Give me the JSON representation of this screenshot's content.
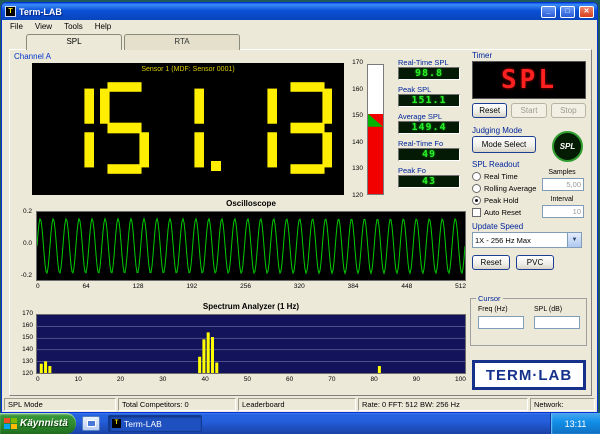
{
  "window": {
    "title": "Term-LAB",
    "menu": [
      "File",
      "View",
      "Tools",
      "Help"
    ],
    "tabs": [
      "SPL",
      "RTA"
    ]
  },
  "channel": {
    "label": "Channel A"
  },
  "main_display": {
    "sensor_label": "Sensor 1 (MDF: Sensor 0001)",
    "value": "151.13",
    "digit_color": "#ffee00",
    "bg_color": "#000000"
  },
  "meter": {
    "min": 120,
    "max": 170,
    "ticks": [
      170,
      160,
      150,
      140,
      130,
      120
    ],
    "fill_to": 151.1,
    "green_band": [
      149.4,
      151.1
    ],
    "fill_color": "#f20000",
    "band_color": "#00b400"
  },
  "readouts": [
    {
      "label": "Real-Time SPL",
      "value": "98.8"
    },
    {
      "label": "Peak SPL",
      "value": "151.1"
    },
    {
      "label": "Average SPL",
      "value": "149.4"
    },
    {
      "label": "Real-Time Fo",
      "value": "49"
    },
    {
      "label": "Peak Fo",
      "value": "43"
    }
  ],
  "timer": {
    "label": "Timer",
    "display": "SPL",
    "buttons": [
      {
        "label": "Reset",
        "enabled": true
      },
      {
        "label": "Start",
        "enabled": false
      },
      {
        "label": "Stop",
        "enabled": false
      }
    ]
  },
  "judging_mode": {
    "label": "Judging Mode",
    "button": "Mode Select",
    "logo": "SPL"
  },
  "spl_readout": {
    "label": "SPL Readout",
    "options": [
      {
        "label": "Real Time",
        "selected": false
      },
      {
        "label": "Rolling Average",
        "selected": false
      },
      {
        "label": "Peak Hold",
        "selected": true
      }
    ],
    "auto_reset": {
      "label": "Auto Reset",
      "checked": false
    },
    "samples": {
      "label": "Samples",
      "value": "5,00"
    },
    "interval": {
      "label": "Interval",
      "value": "10"
    }
  },
  "update_speed": {
    "label": "Update Speed",
    "value": "1X - 256 Hz Max"
  },
  "buttons": {
    "reset": "Reset",
    "pvc": "PVC"
  },
  "cursor": {
    "label": "Cursor",
    "freq_label": "Freq (Hz)",
    "spl_label": "SPL (dB)",
    "freq_value": "",
    "spl_value": ""
  },
  "logo": {
    "text": "TERM·LAB"
  },
  "status_bar": [
    "SPL Mode",
    "Total Competitors: 0",
    "Leaderboard",
    "Rate: 0 FFT: 512 BW: 256 Hz",
    "Network:"
  ],
  "taskbar": {
    "start_label": "Käynnistä",
    "task_label": "Term-LAB",
    "clock": "13:11"
  },
  "colors": {
    "led": "#2bee2b",
    "timer_display": "#ff2020",
    "label_blue": "#00259c"
  },
  "chart_data": [
    {
      "type": "line",
      "title": "Oscilloscope",
      "xlabel": "",
      "ylabel": "",
      "xlim": [
        0,
        512
      ],
      "ylim": [
        -0.25,
        0.25
      ],
      "x_ticks": [
        0,
        64,
        128,
        192,
        256,
        320,
        384,
        448,
        512
      ],
      "y_tick_labels": [
        "0.2",
        "0.0",
        "-0.2"
      ],
      "waveform": {
        "shape": "sine",
        "amplitude": 0.2,
        "cycles": 33
      },
      "line_color": "#00cc00",
      "bg_color": "#000000",
      "grid": false,
      "legend": false
    },
    {
      "type": "bar",
      "title": "Spectrum Analyzer (1 Hz)",
      "xlabel": "",
      "ylabel": "",
      "xlim": [
        0,
        100
      ],
      "ylim": [
        120,
        170
      ],
      "x_ticks": [
        0,
        10,
        20,
        30,
        40,
        50,
        60,
        70,
        80,
        90,
        100
      ],
      "y_ticks": [
        170,
        160,
        150,
        140,
        130,
        120
      ],
      "gridlines": [
        130,
        140,
        150,
        160
      ],
      "bars": [
        {
          "x": 1,
          "v": 128
        },
        {
          "x": 2,
          "v": 130
        },
        {
          "x": 3,
          "v": 126
        },
        {
          "x": 38,
          "v": 134
        },
        {
          "x": 39,
          "v": 149
        },
        {
          "x": 40,
          "v": 155
        },
        {
          "x": 41,
          "v": 151
        },
        {
          "x": 42,
          "v": 129
        },
        {
          "x": 80,
          "v": 126
        }
      ],
      "bar_color": "#ffff00",
      "bg_color": "#13135c",
      "grid_color": "#8a8ab8",
      "legend": false
    }
  ]
}
